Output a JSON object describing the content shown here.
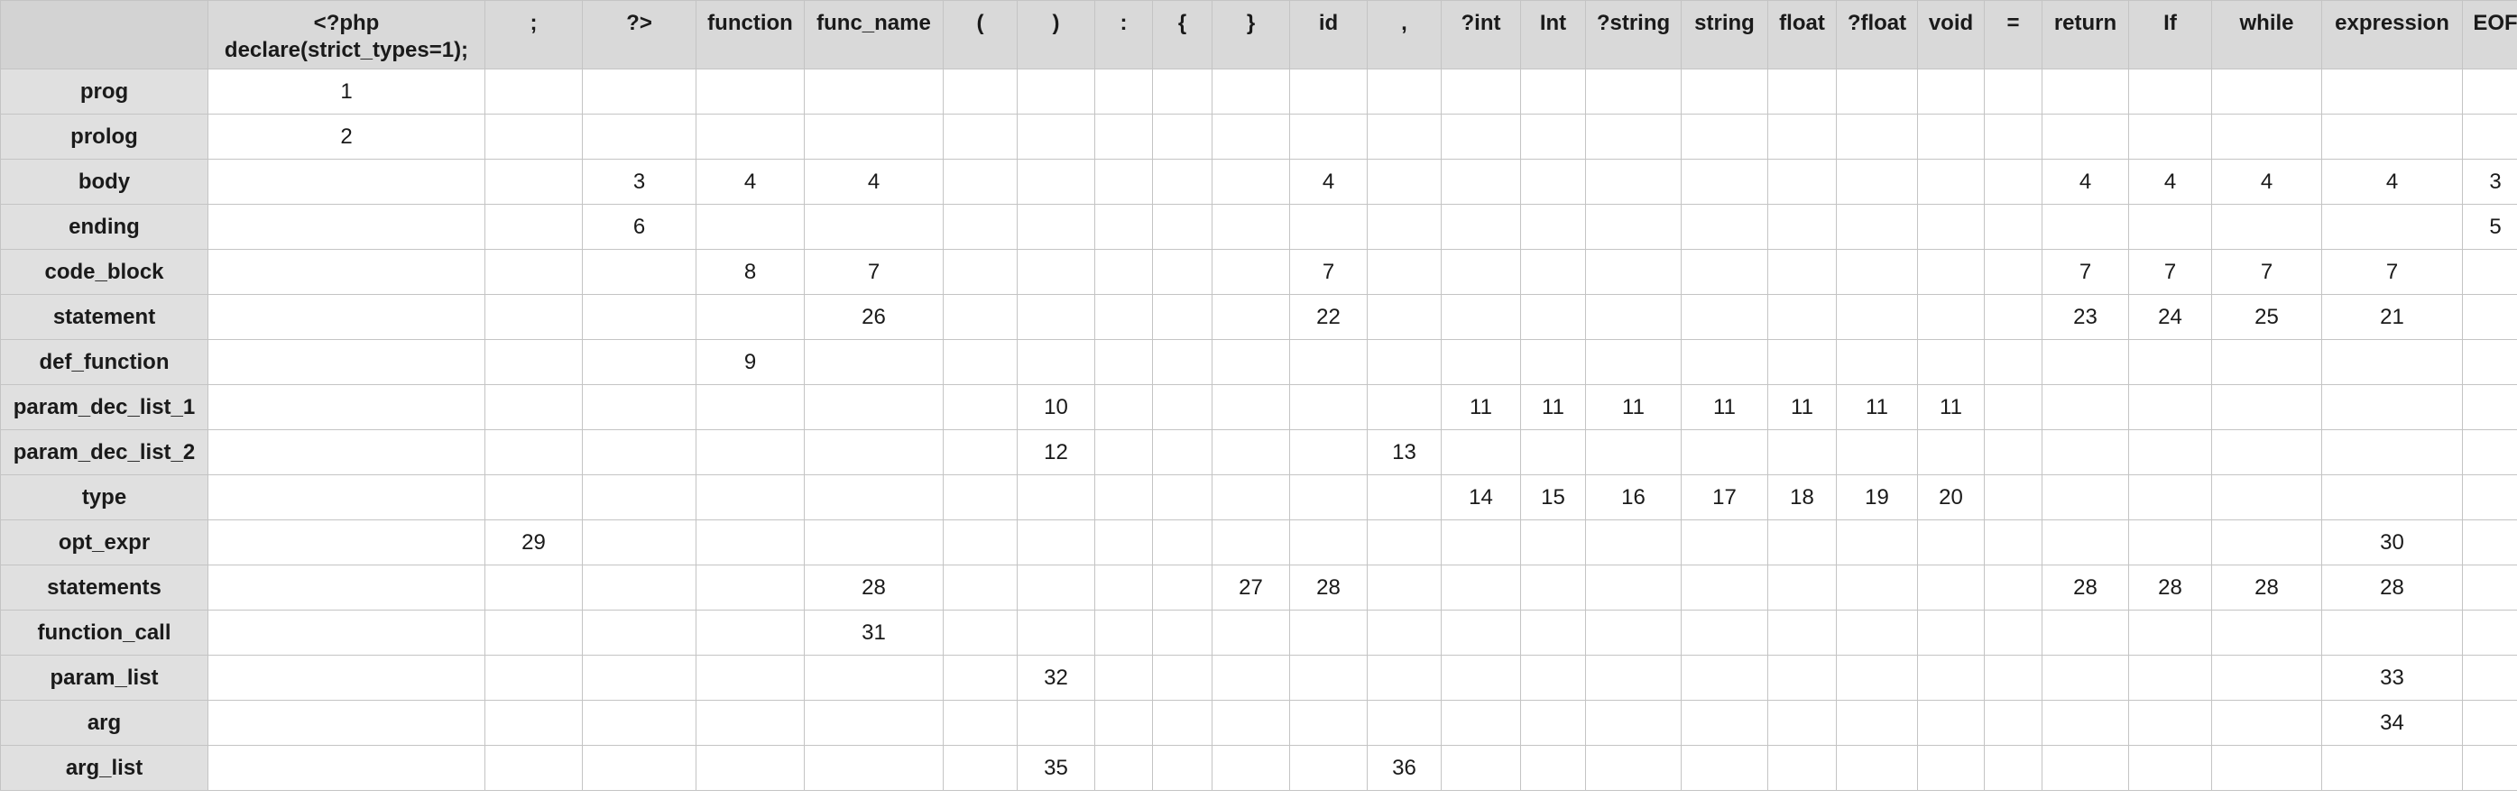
{
  "table": {
    "columns": [
      "",
      "<?php declare(strict_types=1);",
      ";",
      "?>",
      "function",
      "func_name",
      "(",
      ")",
      ":",
      "{",
      "}",
      "id",
      ",",
      "?int",
      "Int",
      "?string",
      "string",
      "float",
      "?float",
      "void",
      "=",
      "return",
      "If",
      "while",
      "expression",
      "EOF"
    ],
    "rows": [
      {
        "label": "prog",
        "cells": [
          "1",
          "",
          "",
          "",
          "",
          "",
          "",
          "",
          "",
          "",
          "",
          "",
          "",
          "",
          "",
          "",
          "",
          "",
          "",
          "",
          "",
          "",
          "",
          ""
        ]
      },
      {
        "label": "prolog",
        "cells": [
          "2",
          "",
          "",
          "",
          "",
          "",
          "",
          "",
          "",
          "",
          "",
          "",
          "",
          "",
          "",
          "",
          "",
          "",
          "",
          "",
          "",
          "",
          "",
          ""
        ]
      },
      {
        "label": "body",
        "cells": [
          "",
          "",
          "3",
          "4",
          "4",
          "",
          "",
          "",
          "",
          "",
          "4",
          "",
          "",
          "",
          "",
          "",
          "",
          "",
          "",
          "",
          "4",
          "4",
          "4",
          "4",
          "3"
        ]
      },
      {
        "label": "ending",
        "cells": [
          "",
          "",
          "6",
          "",
          "",
          "",
          "",
          "",
          "",
          "",
          "",
          "",
          "",
          "",
          "",
          "",
          "",
          "",
          "",
          "",
          "",
          "",
          "",
          "",
          "5"
        ]
      },
      {
        "label": "code_block",
        "cells": [
          "",
          "",
          "",
          "8",
          "7",
          "",
          "",
          "",
          "",
          "",
          "7",
          "",
          "",
          "",
          "",
          "",
          "",
          "",
          "",
          "",
          "7",
          "7",
          "7",
          "7",
          ""
        ]
      },
      {
        "label": "statement",
        "cells": [
          "",
          "",
          "",
          "",
          "26",
          "",
          "",
          "",
          "",
          "",
          "22",
          "",
          "",
          "",
          "",
          "",
          "",
          "",
          "",
          "",
          "23",
          "24",
          "25",
          "21",
          ""
        ]
      },
      {
        "label": "def_function",
        "cells": [
          "",
          "",
          "",
          "9",
          "",
          "",
          "",
          "",
          "",
          "",
          "",
          "",
          "",
          "",
          "",
          "",
          "",
          "",
          "",
          "",
          "",
          "",
          "",
          "",
          ""
        ]
      },
      {
        "label": "param_dec_list_1",
        "cells": [
          "",
          "",
          "",
          "",
          "",
          "",
          "10",
          "",
          "",
          "",
          "",
          "",
          "11",
          "11",
          "11",
          "11",
          "11",
          "11",
          "11",
          "",
          "",
          "",
          "",
          "",
          ""
        ]
      },
      {
        "label": "param_dec_list_2",
        "cells": [
          "",
          "",
          "",
          "",
          "",
          "",
          "12",
          "",
          "",
          "",
          "",
          "13",
          "",
          "",
          "",
          "",
          "",
          "",
          "",
          "",
          "",
          "",
          "",
          "",
          ""
        ]
      },
      {
        "label": "type",
        "cells": [
          "",
          "",
          "",
          "",
          "",
          "",
          "",
          "",
          "",
          "",
          "",
          "",
          "14",
          "15",
          "16",
          "17",
          "18",
          "19",
          "20",
          "",
          "",
          "",
          "",
          "",
          ""
        ]
      },
      {
        "label": "opt_expr",
        "cells": [
          "",
          "29",
          "",
          "",
          "",
          "",
          "",
          "",
          "",
          "",
          "",
          "",
          "",
          "",
          "",
          "",
          "",
          "",
          "",
          "",
          "",
          "",
          "",
          "30",
          ""
        ]
      },
      {
        "label": "statements",
        "cells": [
          "",
          "",
          "",
          "",
          "28",
          "",
          "",
          "",
          "",
          "27",
          "28",
          "",
          "",
          "",
          "",
          "",
          "",
          "",
          "",
          "",
          "28",
          "28",
          "28",
          "28",
          ""
        ]
      },
      {
        "label": "function_call",
        "cells": [
          "",
          "",
          "",
          "",
          "31",
          "",
          "",
          "",
          "",
          "",
          "",
          "",
          "",
          "",
          "",
          "",
          "",
          "",
          "",
          "",
          "",
          "",
          "",
          "",
          ""
        ]
      },
      {
        "label": "param_list",
        "cells": [
          "",
          "",
          "",
          "",
          "",
          "",
          "32",
          "",
          "",
          "",
          "",
          "",
          "",
          "",
          "",
          "",
          "",
          "",
          "",
          "",
          "",
          "",
          "",
          "33",
          ""
        ]
      },
      {
        "label": "arg",
        "cells": [
          "",
          "",
          "",
          "",
          "",
          "",
          "",
          "",
          "",
          "",
          "",
          "",
          "",
          "",
          "",
          "",
          "",
          "",
          "",
          "",
          "",
          "",
          "",
          "34",
          ""
        ]
      },
      {
        "label": "arg_list",
        "cells": [
          "",
          "",
          "",
          "",
          "",
          "",
          "35",
          "",
          "",
          "",
          "",
          "36",
          "",
          "",
          "",
          "",
          "",
          "",
          "",
          "",
          "",
          "",
          "",
          "",
          ""
        ]
      }
    ]
  }
}
